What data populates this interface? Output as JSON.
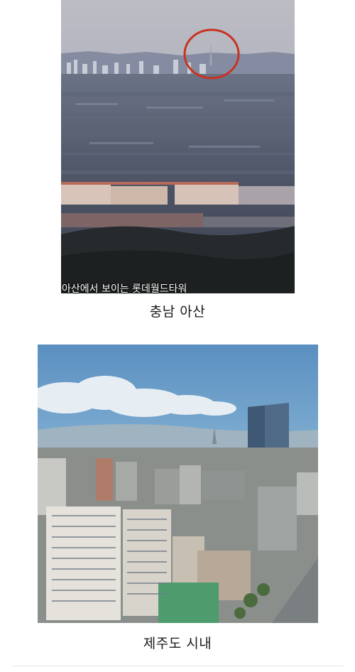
{
  "posts": [
    {
      "overlay_text": "아산에서 보이는 롯데월드타워",
      "caption": "충남 아산"
    },
    {
      "caption": "제주도 시내"
    }
  ]
}
